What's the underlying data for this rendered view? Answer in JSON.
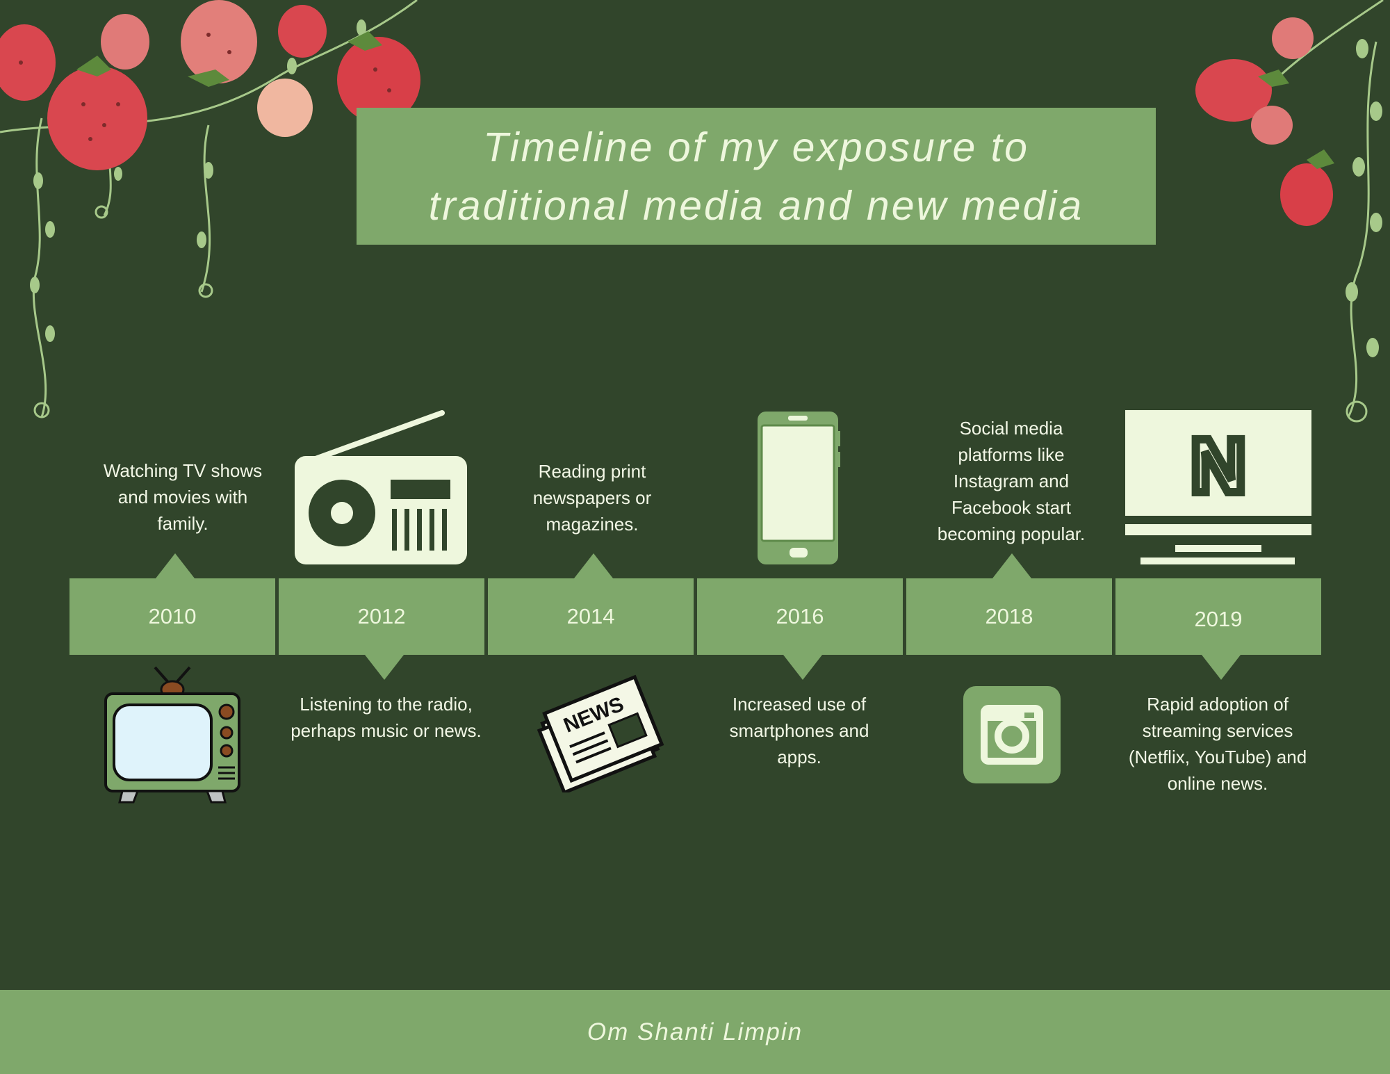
{
  "title": {
    "line1": "Timeline of my exposure to",
    "line2": "traditional media and new media"
  },
  "timeline": [
    {
      "year": "2010",
      "description": "Watching TV shows and movies with family.",
      "icon": "tv-icon"
    },
    {
      "year": "2012",
      "description": "Listening to the radio, perhaps music or news.",
      "icon": "radio-icon"
    },
    {
      "year": "2014",
      "description": "Reading print newspapers or magazines.",
      "icon": "newspaper-icon"
    },
    {
      "year": "2016",
      "description": "Increased use of smartphones and apps.",
      "icon": "smartphone-icon"
    },
    {
      "year": "2018",
      "description": "Social media platforms like Instagram and Facebook start becoming popular.",
      "icon": "instagram-icon"
    },
    {
      "year": "2019",
      "description": "Rapid adoption of streaming services (Netflix, YouTube) and online news.",
      "icon": "netflix-tv-icon"
    }
  ],
  "newspaper_icon_text": "NEWS",
  "netflix_icon_text": "N",
  "footer": {
    "author": "Om Shanti Limpin"
  },
  "colors": {
    "background": "#31452b",
    "accent_green": "#7fa86b",
    "cream": "#eef7dd",
    "strawberry": "#d9474f"
  }
}
